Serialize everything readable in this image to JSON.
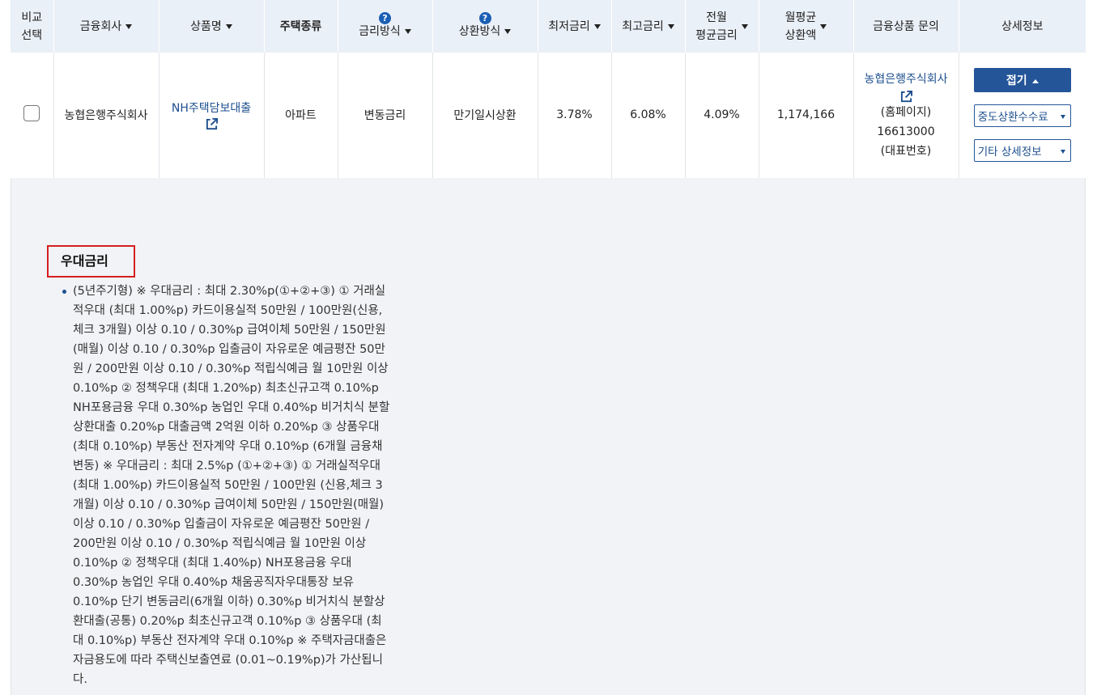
{
  "header": {
    "compare": "비교\n선택",
    "company": "금융회사",
    "product": "상품명",
    "house_type": "주택종류",
    "rate_type": "금리방식",
    "repay_type": "상환방식",
    "min_rate": "최저금리",
    "max_rate": "최고금리",
    "prev_avg_rate": "전월\n평균금리",
    "monthly_repay": "월평균\n상환액",
    "inquiry": "금융상품 문의",
    "detail": "상세정보",
    "help_glyph": "?"
  },
  "row": {
    "company": "농협은행주식회사",
    "product": "NH주택담보대출",
    "house_type": "아파트",
    "rate_type": "변동금리",
    "repay_type": "만기일시상환",
    "min_rate": "3.78%",
    "max_rate": "6.08%",
    "prev_avg_rate": "4.09%",
    "monthly_repay": "1,174,166",
    "inquiry_company": "농협은행주식회사",
    "inquiry_homepage": "(홈페이지)",
    "inquiry_phone": "16613000",
    "inquiry_phone_label": "(대표번호)",
    "btn_fold": "접기",
    "btn_prepay_fee": "중도상환수수료",
    "btn_other_detail": "기타 상세정보"
  },
  "detail": {
    "title": "우대금리",
    "text": "(5년주기형) ※ 우대금리 : 최대 2.30%p(①+②+③) ① 거래실적우대 (최대 1.00%p) 카드이용실적 50만원 / 100만원(신용,체크 3개월) 이상 0.10 / 0.30%p 급여이체 50만원 / 150만원(매월) 이상 0.10 / 0.30%p 입출금이 자유로운 예금평잔 50만원 / 200만원 이상 0.10 / 0.30%p 적립식예금 월 10만원 이상 0.10%p ② 정책우대 (최대 1.20%p) 최초신규고객 0.10%p NH포용금융 우대 0.30%p 농업인 우대 0.40%p 비거치식 분할상환대출 0.20%p 대출금액 2억원 이하 0.20%p ③ 상품우대(최대 0.10%p) 부동산 전자계약 우대 0.10%p (6개월 금융채 변동) ※ 우대금리 : 최대 2.5%p (①+②+③) ① 거래실적우대 (최대 1.00%p) 카드이용실적 50만원 / 100만원 (신용,체크 3개월) 이상 0.10 / 0.30%p 급여이체 50만원 / 150만원(매월) 이상 0.10 / 0.30%p 입출금이 자유로운 예금평잔 50만원 / 200만원 이상 0.10 / 0.30%p 적립식예금 월 10만원 이상 0.10%p ② 정책우대 (최대 1.40%p) NH포용금융 우대 0.30%p 농업인 우대 0.40%p 채움공직자우대통장 보유 0.10%p 단기 변동금리(6개월 이하) 0.30%p 비거치식 분할상환대출(공통) 0.20%p 최초신규고객 0.10%p ③ 상품우대 (최대 0.10%p) 부동산 전자계약 우대 0.10%p ※ 주택자금대출은 자금용도에 따라 주택신보출연료 (0.01~0.19%p)가 가산됩니다."
  },
  "colors": {
    "header_bg": "#eaf0f7",
    "link": "#1d4f8f",
    "button_primary": "#245599",
    "highlight_border": "#d61f1f",
    "detail_bg": "#f1f3f6"
  }
}
